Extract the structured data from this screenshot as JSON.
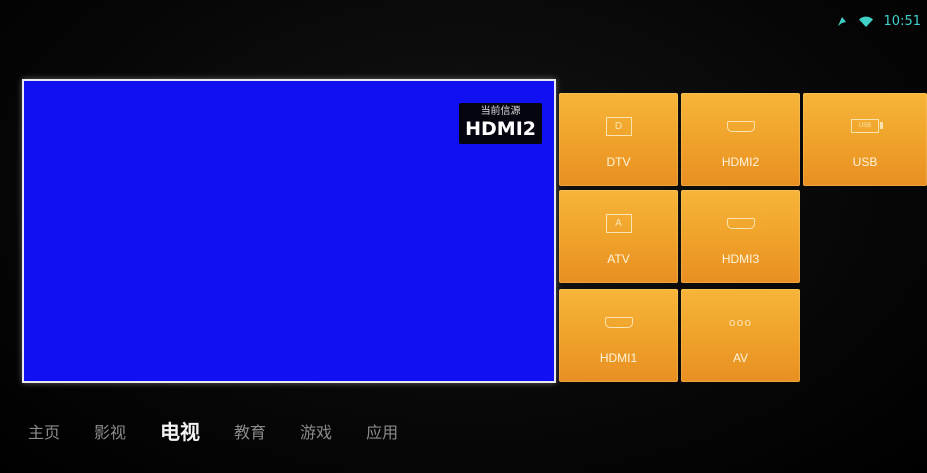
{
  "status": {
    "time": "10:51"
  },
  "preview": {
    "source_caption": "当前信源",
    "source_value": "HDMI2"
  },
  "sources": [
    {
      "label": "DTV",
      "icon": "dtv-icon",
      "icon_text": "D"
    },
    {
      "label": "HDMI2",
      "icon": "hdmi-icon"
    },
    {
      "label": "USB",
      "icon": "usb-icon",
      "icon_text": "USB"
    },
    {
      "label": "ATV",
      "icon": "atv-icon",
      "icon_text": "A"
    },
    {
      "label": "HDMI3",
      "icon": "hdmi-icon"
    },
    {
      "label": "HDMI1",
      "icon": "hdmi-icon"
    },
    {
      "label": "AV",
      "icon": "av-icon",
      "icon_text": "ooo"
    }
  ],
  "nav": {
    "items": [
      "主页",
      "影视",
      "电视",
      "教育",
      "游戏",
      "应用"
    ],
    "active": "电视"
  },
  "colors": {
    "preview_bg": "#1010f2",
    "tile": "#efa12a",
    "status_accent": "#3fd0c8"
  }
}
